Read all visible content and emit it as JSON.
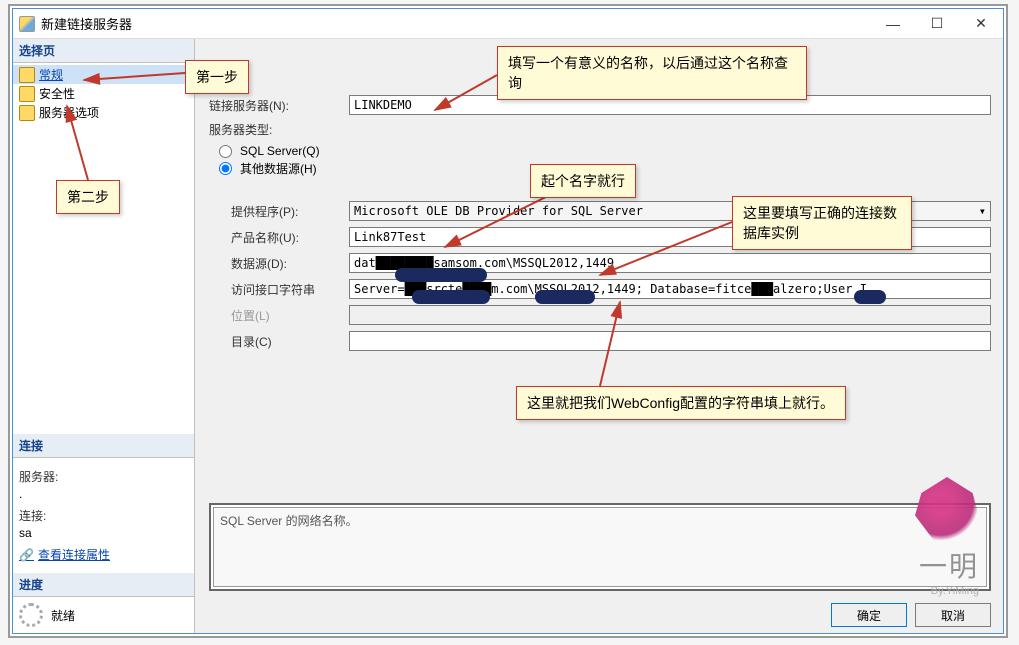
{
  "window": {
    "title": "新建链接服务器"
  },
  "left": {
    "header_choose": "选择页",
    "nav": {
      "general": "常规",
      "security": "安全性",
      "server_options": "服务器选项"
    },
    "header_conn": "连接",
    "server_label": "服务器:",
    "server_value": ".",
    "conn_label": "连接:",
    "conn_value": "sa",
    "view_props": "查看连接属性",
    "header_progress": "进度",
    "ready": "就绪"
  },
  "form": {
    "linked_server_label": "链接服务器(N):",
    "linked_server_value": "LINKDEMO",
    "server_type_label": "服务器类型:",
    "radio_sqlserver": "SQL Server(Q)",
    "radio_other": "其他数据源(H)",
    "provider_label": "提供程序(P):",
    "provider_value": "Microsoft OLE DB Provider for SQL Server",
    "product_label": "产品名称(U):",
    "product_value": "Link87Test",
    "datasource_label": "数据源(D):",
    "datasource_value": "dat████████samsom.com\\MSSQL2012,1449",
    "connstr_label": "访问接口字符串",
    "connstr_value": "Server=███srcte████m.com\\MSSQL2012,1449; Database=fitce███alzero;User I",
    "location_label": "位置(L)",
    "catalog_label": "目录(C)"
  },
  "hint": "SQL Server 的网络名称。",
  "buttons": {
    "ok": "确定",
    "cancel": "取消"
  },
  "callouts": {
    "step1": "第一步",
    "step2": "第二步",
    "name_desc": "填写一个有意义的名称，以后通过这个名称查询",
    "just_name": "起个名字就行",
    "correct_instance": "这里要填写正确的连接数据库实例",
    "webconfig": "这里就把我们WebConfig配置的字符串填上就行。"
  },
  "watermark": {
    "main": "一明",
    "sub": "By.YiMing"
  }
}
